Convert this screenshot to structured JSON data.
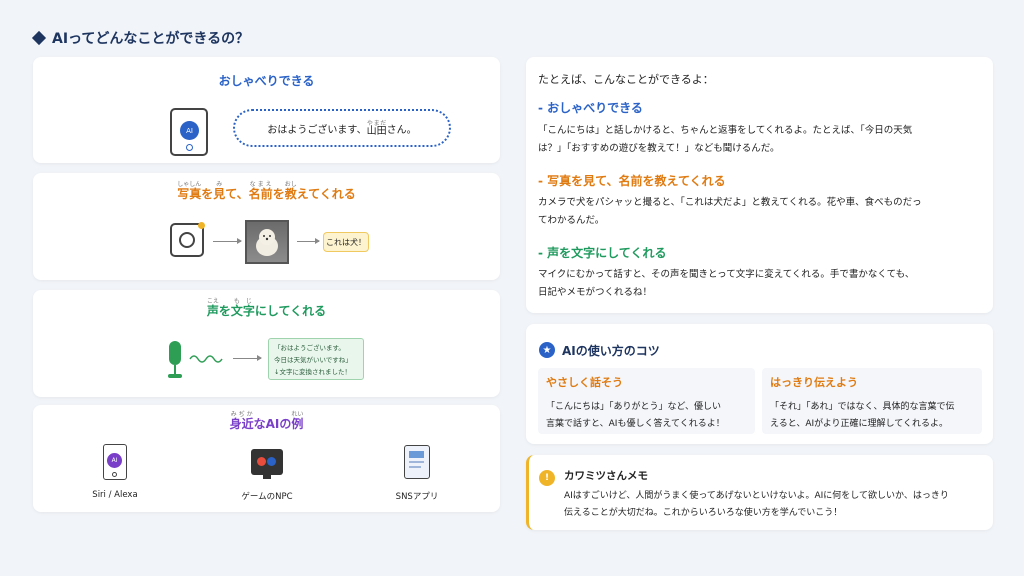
{
  "title": "AIってどんなことができるの？",
  "talk": {
    "title": "おしゃべりできる",
    "bubble_pre": "おはようございます、",
    "bubble_name": "山田",
    "bubble_name_ruby": "やまだ",
    "bubble_post": "さん。",
    "phone_label": "AI"
  },
  "photo": {
    "title_pre": "写真",
    "title_pre_ruby": "しゃしん",
    "title_mid1": "を",
    "title_mid2": "見",
    "title_mid2_ruby": "み",
    "title_mid3": "て、",
    "title_name": "名前",
    "title_name_ruby": "なまえ",
    "title_mid4": "を",
    "title_teach": "教",
    "title_teach_ruby": "おし",
    "title_post": "えてくれる",
    "result": "これは犬！"
  },
  "voice": {
    "title_a": "声",
    "title_a_ruby": "こえ",
    "title_b": "を",
    "title_c": "文字",
    "title_c_ruby": "もじ",
    "title_d": "にしてくれる",
    "box_line1": "「おはようございます。",
    "box_line2": "今日は天気がいいですね」",
    "box_line3": "↓文字に変換されました！"
  },
  "nearby": {
    "title_a": "身近",
    "title_a_ruby": "みぢか",
    "title_b": "な",
    "title_c": "AI",
    "title_d": "の",
    "title_e": "例",
    "title_e_ruby": "れい",
    "items": [
      {
        "label": "Siri / Alexa"
      },
      {
        "label": "ゲームのNPC"
      },
      {
        "label": "SNSアプリ"
      }
    ],
    "phone_label": "AI"
  },
  "examples": {
    "intro": "たとえば、こんなことができるよ：",
    "h1": "- おしゃべりできる",
    "p1_l1": "「こんにちは」と話しかけると、ちゃんと返事をしてくれるよ。たとえば、「今日の天気",
    "p1_l2": "は？」「おすすめの遊びを教えて！」なども聞けるんだ。",
    "h2": "- 写真を見て、名前を教えてくれる",
    "p2_l1": "カメラで犬をパシャッと撮ると、「これは犬だよ」と教えてくれる。花や車、食べものだっ",
    "p2_l2": "てわかるんだ。",
    "h3": "- 声を文字にしてくれる",
    "p3_l1": "マイクにむかって話すと、その声を聞きとって文字に変えてくれる。手で書かなくても、",
    "p3_l2": "日記やメモがつくれるね！"
  },
  "tips": {
    "title": "AIの使い方のコツ",
    "col1_title": "やさしく話そう",
    "col1_l1": "「こんにちは」「ありがとう」など、優しい",
    "col1_l2": "言葉で話すと、AIも優しく答えてくれるよ！",
    "col2_title": "はっきり伝えよう",
    "col2_l1": "「それ」「あれ」ではなく、具体的な言葉で伝",
    "col2_l2": "えると、AIがより正確に理解してくれるよ。"
  },
  "memo": {
    "title": "カワミツさんメモ",
    "l1": "AIはすごいけど、人間がうまく使ってあげないといけないよ。AIに何をして欲しいか、はっきり",
    "l2": "伝えることが大切だね。これからいろいろな使い方を学んでいこう！"
  },
  "colors": {
    "blue": "#2a62c7",
    "orange": "#e07b12",
    "green": "#1f9a5e",
    "purple": "#7a3fc8",
    "navy": "#1e3560"
  }
}
